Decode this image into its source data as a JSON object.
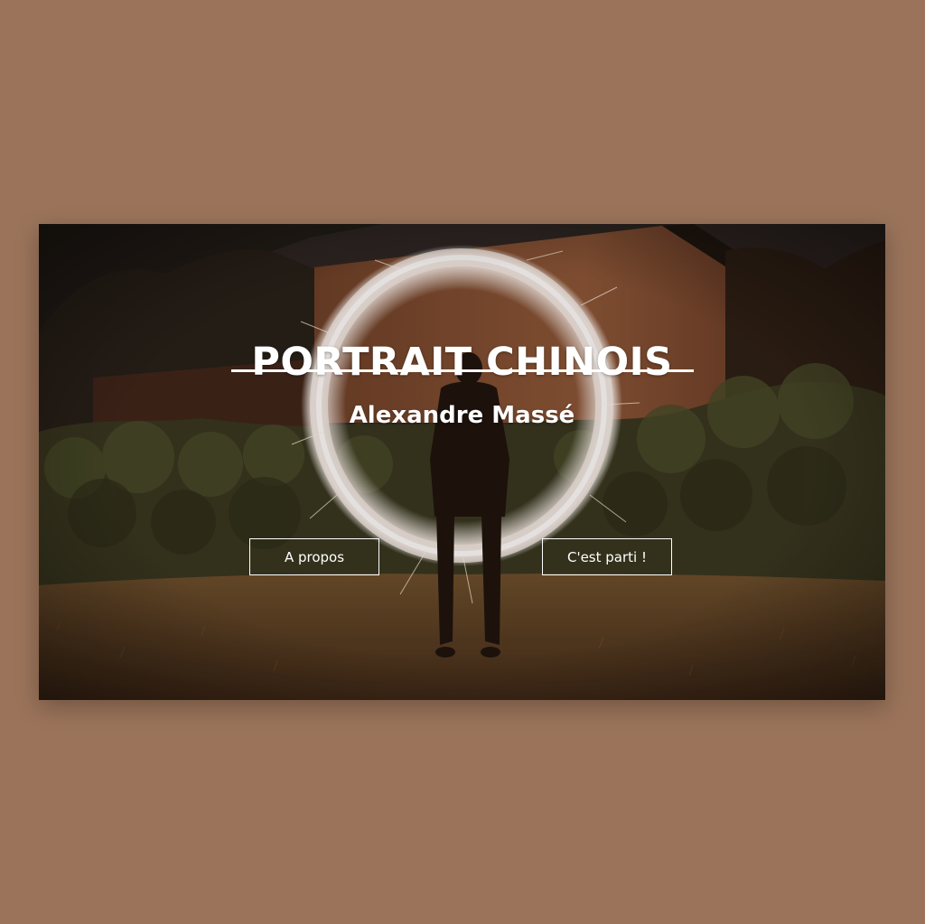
{
  "hero": {
    "title": "PORTRAIT CHINOIS",
    "subtitle": "Alexandre Massé",
    "photo_description_icon": "sparkler-circle-photo"
  },
  "buttons": {
    "about_label": "A propos",
    "start_label": "C'est parti !"
  },
  "colors": {
    "page_background": "#9a735a",
    "text": "#ffffff",
    "button_border": "#ffffff"
  }
}
